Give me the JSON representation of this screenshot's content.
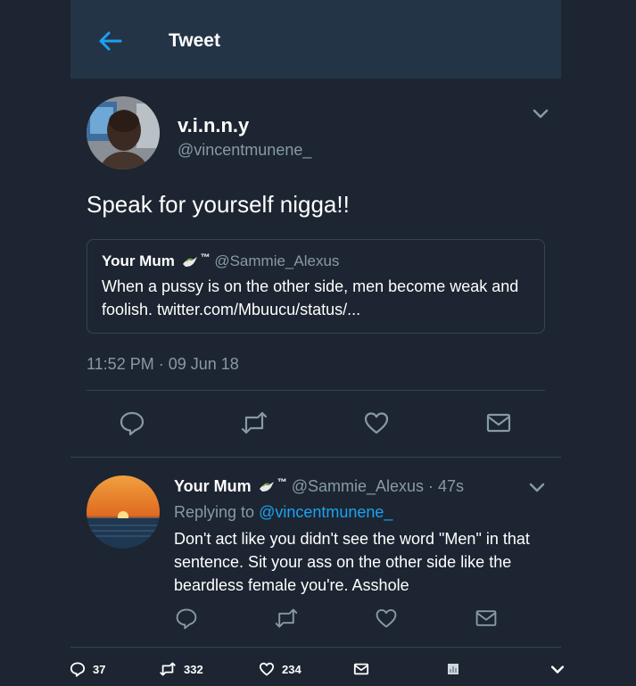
{
  "header": {
    "title": "Tweet"
  },
  "tweet": {
    "display_name": "v.i.n.n.y",
    "handle": "@vincentmunene_",
    "text": "Speak for yourself nigga!!",
    "quote": {
      "name": "Your Mum",
      "tm": "™",
      "handle": "@Sammie_Alexus",
      "body": "When a pussy is on the other side, men become weak and foolish. twitter.com/Mbuucu/status/..."
    },
    "timestamp": "11:52 PM · 09 Jun 18"
  },
  "reply": {
    "name": "Your Mum",
    "tm": "™",
    "handle_time": "@Sammie_Alexus · 47s",
    "replying_prefix": "Replying to ",
    "replying_to": "@vincentmunene_",
    "text": "Don't act like you didn't see the word \"Men\" in that sentence. Sit your ass on the other side like the beardless female you're. Asshole"
  },
  "bottom_bar": {
    "replies": "37",
    "retweets": "332",
    "likes": "234"
  },
  "icons": {
    "back": "back-arrow-icon",
    "caret": "chevron-down-icon",
    "reply": "reply-icon",
    "retweet": "retweet-icon",
    "like": "heart-icon",
    "dm": "envelope-icon",
    "emoji": "dove-emoji"
  },
  "colors": {
    "background": "#1c2531",
    "header": "#243447",
    "accent": "#1da1f2",
    "secondary_text": "#8899a6",
    "border": "#38444d"
  }
}
